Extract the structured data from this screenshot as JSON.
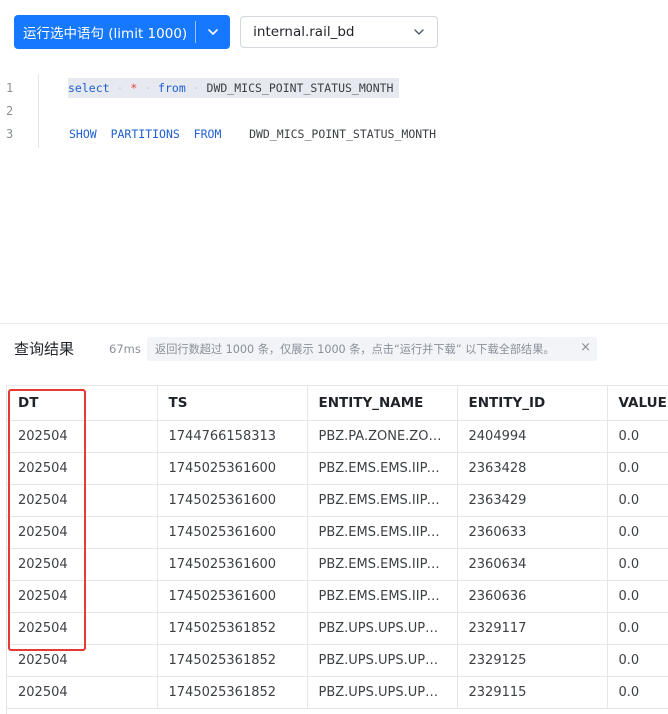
{
  "toolbar": {
    "run_label": "运行选中语句 (limit 1000)",
    "run_dropdown_icon": "chevron-down-icon",
    "database_value": "internal.rail_bd",
    "database_icon": "chevron-down-icon"
  },
  "editor": {
    "line_numbers": [
      "1",
      "2",
      "3"
    ],
    "line1": {
      "kw_select": "select",
      "star": "*",
      "kw_from": "from",
      "table": "DWD_MICS_POINT_STATUS_MONTH"
    },
    "line3": {
      "kw_show": "SHOW",
      "kw_partitions": "PARTITIONS",
      "kw_from": "FROM",
      "table": "DWD_MICS_POINT_STATUS_MONTH"
    }
  },
  "results": {
    "title": "查询结果",
    "time": "67ms",
    "notice": "返回行数超过 1000 条，仅展示 1000 条，点击“运行并下载” 以下载全部结果。",
    "notice_close": "×",
    "columns": [
      "DT",
      "TS",
      "ENTITY_NAME",
      "ENTITY_ID",
      "VALUE"
    ],
    "rows": [
      [
        "202504",
        "1744766158313",
        "PBZ.PA.ZONE.ZON...",
        "2404994",
        "0.0"
      ],
      [
        "202504",
        "1745025361600",
        "PBZ.EMS.EMS.IIPA...",
        "2363428",
        "0.0"
      ],
      [
        "202504",
        "1745025361600",
        "PBZ.EMS.EMS.IIPA...",
        "2363429",
        "0.0"
      ],
      [
        "202504",
        "1745025361600",
        "PBZ.EMS.EMS.IIPA...",
        "2360633",
        "0.0"
      ],
      [
        "202504",
        "1745025361600",
        "PBZ.EMS.EMS.IIPA...",
        "2360634",
        "0.0"
      ],
      [
        "202504",
        "1745025361600",
        "PBZ.EMS.EMS.IIPA...",
        "2360636",
        "0.0"
      ],
      [
        "202504",
        "1745025361852",
        "PBZ.UPS.UPS.UPS....",
        "2329117",
        "0.0"
      ],
      [
        "202504",
        "1745025361852",
        "PBZ.UPS.UPS.UPS....",
        "2329125",
        "0.0"
      ],
      [
        "202504",
        "1745025361852",
        "PBZ.UPS.UPS.UPS....",
        "2329115",
        "0.0"
      ]
    ]
  },
  "colors": {
    "primary": "#1677ff",
    "highlight_box": "#e53935",
    "keyword": "#1f5fd1",
    "operator": "#e0443f"
  }
}
